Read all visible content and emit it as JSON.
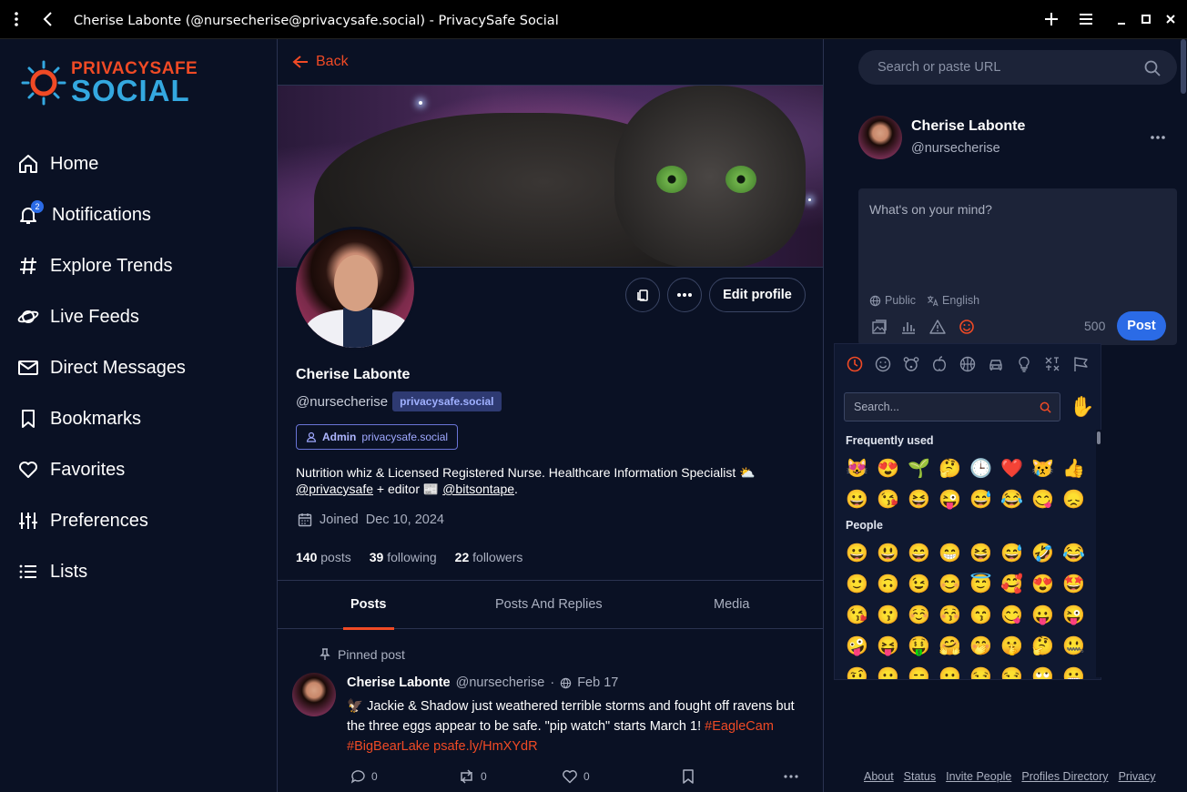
{
  "window": {
    "title": "Cherise Labonte (@nursecherise@privacysafe.social) - PrivacySafe Social"
  },
  "logo": {
    "line1": "PRIVACYSAFE",
    "line2": "SOCIAL"
  },
  "nav": {
    "home": "Home",
    "notifications": "Notifications",
    "notifications_badge": "2",
    "explore": "Explore Trends",
    "live": "Live Feeds",
    "dm": "Direct Messages",
    "bookmarks": "Bookmarks",
    "favorites": "Favorites",
    "preferences": "Preferences",
    "lists": "Lists"
  },
  "profile": {
    "back": "Back",
    "name": "Cherise Labonte",
    "handle": "@nursecherise",
    "domain": "privacysafe.social",
    "role_label": "Admin",
    "role_domain": "privacysafe.social",
    "edit_label": "Edit profile",
    "bio_line1": "Nutrition whiz & Licensed Registered Nurse. Healthcare Information Specialist ⛅",
    "bio_link1": "@privacysafe",
    "bio_mid": " + editor 📰 ",
    "bio_link2": "@bitsontape",
    "bio_end": ".",
    "joined_label": "Joined",
    "joined_date": "Dec 10, 2024",
    "posts_count": "140",
    "posts_label": "posts",
    "following_count": "39",
    "following_label": "following",
    "followers_count": "22",
    "followers_label": "followers"
  },
  "tabs": [
    "Posts",
    "Posts And Replies",
    "Media"
  ],
  "pinned_post": {
    "label": "Pinned post",
    "author": "Cherise Labonte",
    "handle": "@nursecherise",
    "sep": "·",
    "date": "Feb 17",
    "text_line1": "🦅 Jackie & Shadow just weathered terrible storms and fought off ravens but the three eggs appear to be safe. \"pip watch\" starts March 1! ",
    "tag1": "#EagleCam",
    "tag2": "#BigBearLake",
    "link": "psafe.ly/HmXYdR",
    "replies": "0",
    "boosts": "0",
    "favs": "0"
  },
  "right": {
    "search_placeholder": "Search or paste URL",
    "me_name": "Cherise Labonte",
    "me_handle": "@nursecherise",
    "composer_placeholder": "What's on your mind?",
    "visibility": "Public",
    "language": "English",
    "char_count": "500",
    "post_label": "Post"
  },
  "emoji_picker": {
    "search_placeholder": "Search...",
    "skin_tone": "✋",
    "section_frequent": "Frequently used",
    "frequent": [
      "😻",
      "😍",
      "🌱",
      "🤔",
      "🕒",
      "❤️",
      "😿",
      "👍",
      "😀",
      "😘",
      "😆",
      "😜",
      "😅",
      "😂",
      "😋",
      "😞"
    ],
    "section_people": "People",
    "people": [
      "😀",
      "😃",
      "😄",
      "😁",
      "😆",
      "😅",
      "🤣",
      "😂",
      "🙂",
      "🙃",
      "😉",
      "😊",
      "😇",
      "🥰",
      "😍",
      "🤩",
      "😘",
      "😗",
      "☺️",
      "😚",
      "😙",
      "😋",
      "😛",
      "😜",
      "🤪",
      "😝",
      "🤑",
      "🤗",
      "🤭",
      "🤫",
      "🤔",
      "🤐",
      "🤨",
      "😐",
      "😑",
      "😶",
      "😏",
      "😒",
      "🙄",
      "😬"
    ]
  },
  "footer": [
    "About",
    "Status",
    "Invite People",
    "Profiles Directory",
    "Privacy"
  ],
  "colors": {
    "accent": "#f04a25",
    "primary": "#2b6be6",
    "background": "#0a1124"
  }
}
